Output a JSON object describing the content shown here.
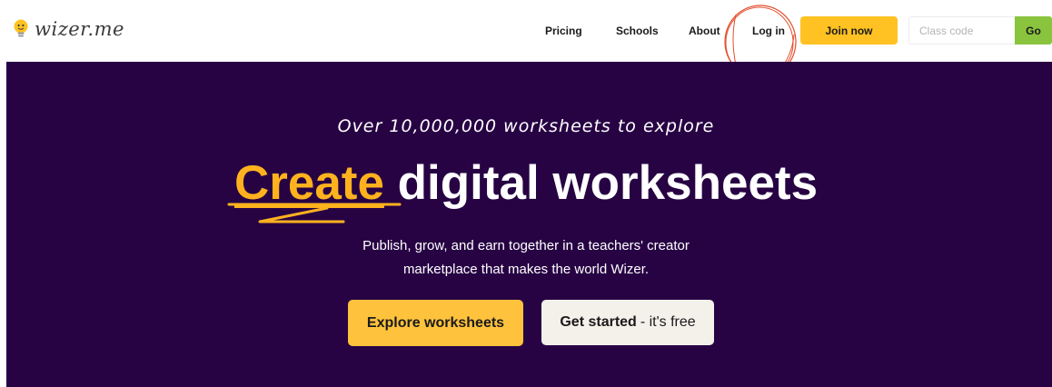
{
  "header": {
    "logo_text": "wizer.me",
    "logo_icon": "lightbulb-icon",
    "nav": [
      "Pricing",
      "Schools",
      "About",
      "Log in"
    ],
    "join_label": "Join now",
    "class_code_placeholder": "Class code",
    "class_code_value": "",
    "go_label": "Go",
    "highlight_color": "#e44e2d"
  },
  "hero": {
    "eyebrow": "Over 10,000,000 worksheets to explore",
    "headline_accent": "Create",
    "headline_rest": "digital worksheets",
    "subtitle_line1": "Publish, grow, and earn together in a teachers' creator",
    "subtitle_line2": "marketplace that makes the world Wizer.",
    "explore_label": "Explore worksheets",
    "get_started_bold": "Get started",
    "get_started_rest": "- it's free"
  },
  "colors": {
    "hero_bg": "#270344",
    "accent_yellow": "#ffc222",
    "go_green": "#8ac43f",
    "create_orange": "#ffb21e"
  }
}
